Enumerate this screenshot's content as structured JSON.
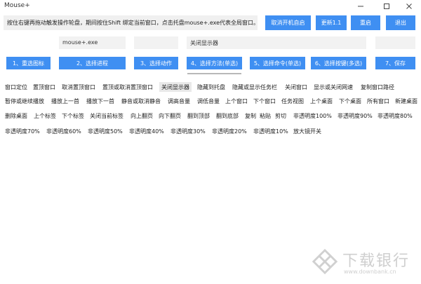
{
  "window": {
    "title": "Mouse+",
    "min_icon": "minimize-icon",
    "max_icon": "maximize-icon",
    "close_icon": "close-icon"
  },
  "hint": "按住右键再拖动触发操作轮盘，期间按住Shift 绑定当前窗口，点击托盘mouse+.exe代表全局窗口。",
  "top_buttons": {
    "autostart": "取消开机自启",
    "update": "更新1.1",
    "restart": "重启",
    "exit": "退出"
  },
  "fields": {
    "process": "mouse+.exe",
    "action_blank": "",
    "method": "关闭显示器",
    "extra_blank": ""
  },
  "steps": {
    "s1": "1、重选图标",
    "s2": "2、选择进程",
    "s3": "3、选择动作",
    "s4": "4、选择方法(单选)",
    "s5": "5、选择命令(单选)",
    "s6": "6、选择按键(多选)",
    "s7": "7、保存"
  },
  "actions": {
    "row1": [
      "窗口定位",
      "置顶窗口",
      "取消置顶窗口",
      "置顶或取消置顶窗口",
      "关闭显示器",
      "隐藏到托盘",
      "隐藏或显示任务栏",
      "关闭窗口",
      "显示或关闭网速",
      "复制窗口路径"
    ],
    "row2": [
      "暂停或继续播放",
      "播放上一首",
      "播放下一首",
      "静音或取消静音",
      "调高音量",
      "调低音量",
      "上个窗口",
      "下个窗口",
      "任务视图",
      "上个桌面",
      "下个桌面",
      "所有窗口",
      "新建桌面"
    ],
    "row3": [
      "删除桌面",
      "上个标签",
      "下个标签",
      "关闭当前标签",
      "向上翻页",
      "向下翻页",
      "翻到顶部",
      "翻到底部",
      "复制",
      "粘贴",
      "剪切",
      "非透明度100%",
      "非透明度90%",
      "非透明度80%"
    ],
    "row4": [
      "非透明度70%",
      "非透明度60%",
      "非透明度50%",
      "非透明度40%",
      "非透明度30%",
      "非透明度20%",
      "非透明度10%",
      "放大镜开关"
    ]
  },
  "watermark": {
    "text": "下载银行",
    "url": "www.downbank.cn",
    "logo_icon": "downbank-logo-icon"
  }
}
